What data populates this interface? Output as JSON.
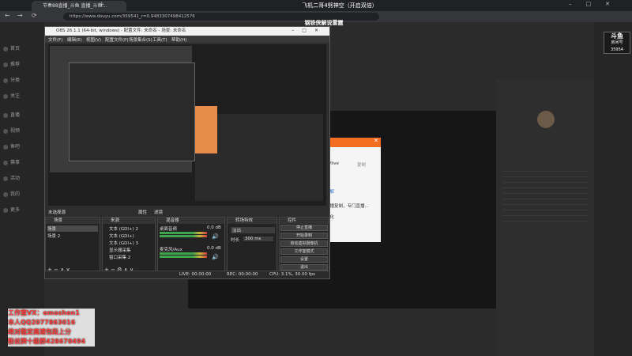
{
  "browser": {
    "tab_title": "节奏88直播_斗鱼 直播_斗鱼...",
    "url": "https://www.douyu.com/359541_r=0.9483307498412576",
    "stream_title": "飞机二哥4劈神空（开启双倍）",
    "stream_subtitle": "钢铁侠解说雷霆",
    "nav_back": "←",
    "nav_forward": "→",
    "nav_reload": "⟳"
  },
  "left_nav": {
    "items": [
      "首页",
      "推荐",
      "分类",
      "关注",
      "直播",
      "视频",
      "鱼吧",
      "赛事",
      "活动",
      "我的",
      "更多"
    ]
  },
  "channel": {
    "logo_line1": "斗鱼",
    "logo_line2": "房间号",
    "room_number": "35954"
  },
  "overlay": {
    "line1": "m/live",
    "line2": "复制",
    "line3": "了解",
    "line4": "重播复制，专门直播...",
    "line5": "变化"
  },
  "obs": {
    "title": "OBS 26.1.1 (64-bit, windows) - 配置文件: 未命名 - 场景: 未命名",
    "menus": [
      "文件(F)",
      "编辑(E)",
      "视图(V)",
      "配置文件(P)",
      "场景集合(S)",
      "工具(T)",
      "帮助(H)"
    ],
    "no_source_label": "未选择源",
    "props_btn": "属性",
    "filter_btn": "滤镜",
    "scenes": {
      "header": "场景",
      "items": [
        "场景",
        "场景 2"
      ]
    },
    "sources": {
      "header": "来源",
      "items": [
        "文本 (GDI+) 2",
        "文本 (GDI+)",
        "文本 (GDI+) 3",
        "显示器采集",
        "窗口采集 2"
      ]
    },
    "mixer": {
      "header": "混音器",
      "tracks": [
        {
          "name": "桌面音频",
          "db": "0.0 dB"
        },
        {
          "name": "麦克风/Aux",
          "db": "0.0 dB"
        }
      ]
    },
    "transitions": {
      "header": "转场特效",
      "type": "淡出",
      "duration_label": "时长",
      "duration": "300 ms"
    },
    "controls": {
      "header": "控件",
      "buttons": [
        "停止直播",
        "开始录制",
        "启动虚拟摄像机",
        "工作室模式",
        "设置",
        "退出"
      ]
    },
    "status": {
      "live": "LIVE: 00:00:00",
      "rec": "REC: 00:00:00",
      "cpu": "CPU: 3.1%, 30.00 fps"
    }
  },
  "watermark": {
    "line1": "工作室VX：emoshen1",
    "line2": "本人QQ2077863016",
    "line3": "绝对稳定高速包段上分",
    "line4": "粉丝牌十级群428670494"
  },
  "colors": {
    "accent": "#f36e21",
    "watermark_text": "#ff3b3b"
  }
}
